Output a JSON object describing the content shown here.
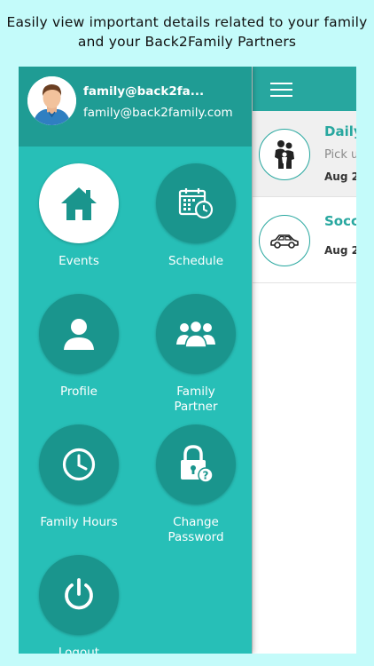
{
  "caption": {
    "line1": "Easily view important details related to your family",
    "line2": "and your Back2Family Partners"
  },
  "drawer": {
    "user_name": "family@back2fa...",
    "user_email": "family@back2family.com",
    "items": [
      {
        "label": "Events",
        "icon": "house-icon"
      },
      {
        "label": "Schedule",
        "icon": "calendar-clock-icon"
      },
      {
        "label": "Profile",
        "icon": "person-icon"
      },
      {
        "label_line1": "Family",
        "label_line2": "Partner",
        "icon": "group-icon"
      },
      {
        "label": "Family Hours",
        "icon": "clock-icon"
      },
      {
        "label_line1": "Change",
        "label_line2": "Password",
        "icon": "lock-question-icon"
      },
      {
        "label": "Logout",
        "icon": "power-icon"
      }
    ]
  },
  "content": {
    "cards": [
      {
        "title": "Daily",
        "subtitle": "Pick u",
        "date": "Aug 2",
        "icon": "family-icon"
      },
      {
        "title": "Socc",
        "date": "Aug 2",
        "icon": "car-icon"
      }
    ]
  },
  "colors": {
    "background": "#c4fbfa",
    "drawer": "#27bfb7",
    "drawer_header": "#1f9c94",
    "accent": "#27a79f",
    "menu_circle": "#1a958d"
  }
}
